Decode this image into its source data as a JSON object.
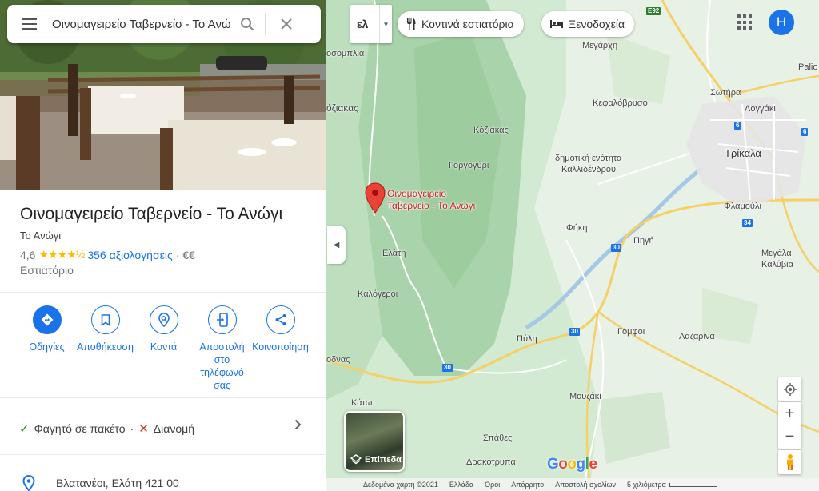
{
  "search": {
    "value": "Οινομαγειρείο Ταβερνείο - Το Ανώγι"
  },
  "place": {
    "title": "Οινομαγειρείο Ταβερνείο - Το Ανώγι",
    "subtitle": "Το Ανώγι",
    "rating": "4,6",
    "stars": 4.6,
    "reviews": "356 αξιολογήσεις",
    "price": "€€",
    "category": "Εστιατόριο"
  },
  "actions": [
    {
      "label": "Οδηγίες",
      "icon": "directions-icon"
    },
    {
      "label": "Αποθήκευση",
      "icon": "bookmark-icon"
    },
    {
      "label": "Κοντά",
      "icon": "nearby-icon"
    },
    {
      "label": "Αποστολή στο τηλέφωνό σας",
      "icon": "send-to-phone-icon"
    },
    {
      "label": "Κοινοποίηση",
      "icon": "share-icon"
    }
  ],
  "services": {
    "takeaway": "Φαγητό σε πακέτο",
    "delivery": "Διανομή",
    "dot": "·"
  },
  "address": "Βλατανέοι, Ελάτη 421 00",
  "map": {
    "lang": "ελ",
    "chip_restaurants": "Κοντινά εστιατόρια",
    "chip_hotels": "Ξενοδοχεία",
    "avatar_letter": "H",
    "pin_label_line1": "Οινομαγειρείο",
    "pin_label_line2": "Ταβερνείο - Το Ανώγι",
    "layers_label": "Επίπεδα",
    "google": "Google",
    "places": {
      "megarchi": "Μεγάρχη",
      "kefalovryso": "Κεφαλόβρυσο",
      "sotira": "Σωτήρα",
      "loggaki": "Λογγάκι",
      "trikala": "Τρίκαλα",
      "koziakas": "Κόζιακας",
      "koziakas_edge": "όζιακας",
      "gorgogyri": "Γοργογύρι",
      "dimotiki1": "δημοτική ενότητα",
      "dimotiki2": "Καλλιδένδρου",
      "flamouli": "Φλαμούλι",
      "fiki": "Φήκη",
      "pigi": "Πηγή",
      "megala1": "Μεγάλα",
      "megala2": "Καλύβια",
      "elati": "Ελάτη",
      "kalogeroi": "Καλόγεροι",
      "gomfoi": "Γόμφοι",
      "lazarina": "Λαζαρίνα",
      "pyli": "Πύλη",
      "mouzaki": "Μουζάκι",
      "spathes": "Σπάθες",
      "drakotrypa": "Δρακότρυπα",
      "kato": "Κάτω",
      "palio": "Palio",
      "dosomplia": "οσομπλιά",
      "odnas": "οδνας"
    },
    "shields": {
      "e92": "E92",
      "r6a": "6",
      "r6b": "6",
      "r34": "34",
      "r30a": "30",
      "r30b": "30",
      "r30c": "30"
    },
    "footer": {
      "data": "Δεδομένα χάρτη ©2021",
      "country": "Ελλάδα",
      "terms": "Όροι",
      "privacy": "Απόρρητο",
      "feedback": "Αποστολή σχολίων",
      "scale": "5 χιλιόμετρα"
    }
  }
}
